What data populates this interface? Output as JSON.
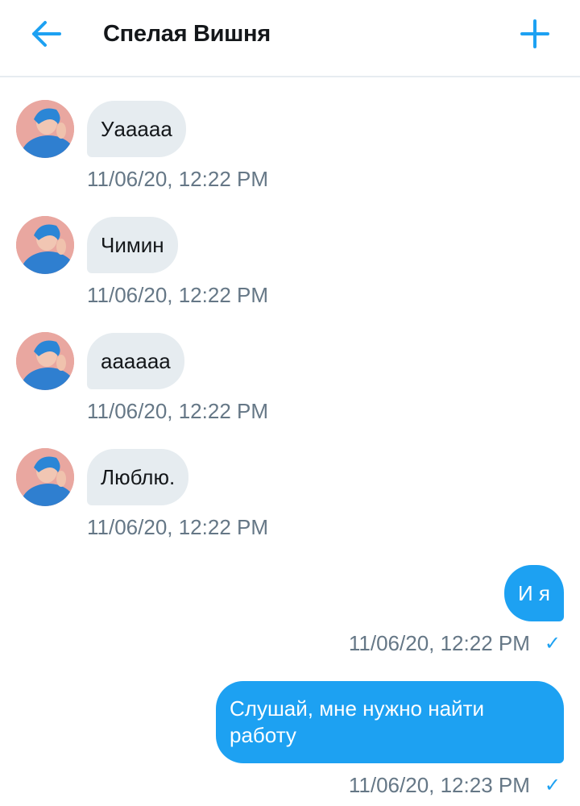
{
  "header": {
    "title": "Спелая Вишня",
    "back_icon": "arrow-left-icon",
    "action_icon": "plus-icon",
    "accent_color": "#1da1f2"
  },
  "messages": [
    {
      "direction": "incoming",
      "text": "Уааааа",
      "time": "11/06/20, 12:22 PM"
    },
    {
      "direction": "incoming",
      "text": "Чимин",
      "time": "11/06/20, 12:22 PM"
    },
    {
      "direction": "incoming",
      "text": "аааааа",
      "time": "11/06/20, 12:22 PM"
    },
    {
      "direction": "incoming",
      "text": "Люблю.",
      "time": "11/06/20, 12:22 PM"
    },
    {
      "direction": "outgoing",
      "text": "И я",
      "time": "11/06/20, 12:22 PM",
      "status_icon": "checkmark-icon"
    },
    {
      "direction": "outgoing",
      "text": "Слушай, мне нужно найти работу",
      "time": "11/06/20, 12:23 PM",
      "status_icon": "checkmark-icon"
    }
  ]
}
